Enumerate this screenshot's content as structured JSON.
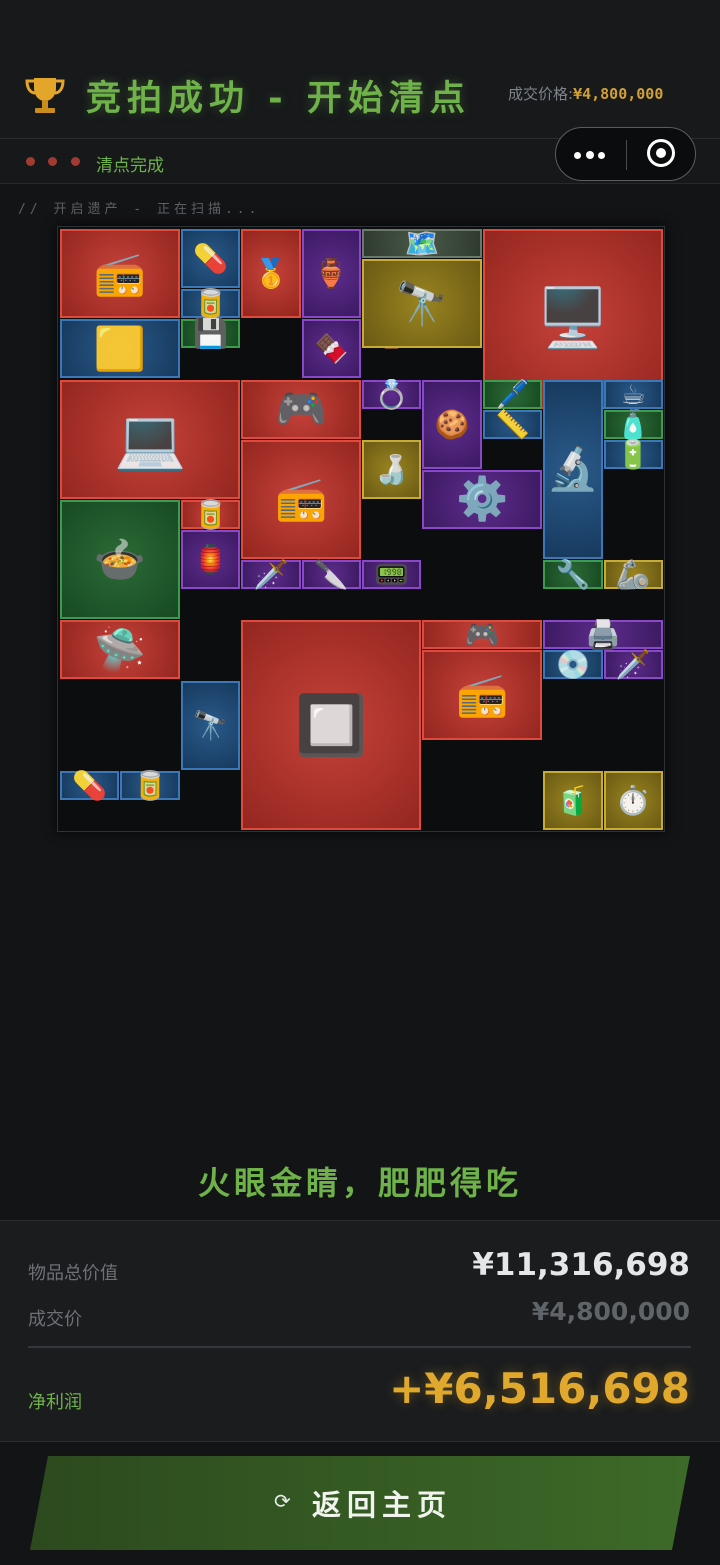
{
  "header": {
    "title": "竞拍成功 - 开始清点",
    "price_label": "成交价格:",
    "price_value": "¥4,800,000"
  },
  "status": {
    "text": "清点完成",
    "dot_color": "#a33a32"
  },
  "mini_program_menu": {
    "more_icon": "more-dots-icon",
    "close_icon": "target-close-icon"
  },
  "scan_text": "// 开启遗产 - 正在扫描...",
  "inventory": {
    "rarity_colors": {
      "red": "#c6423a",
      "blue": "#2a5a8a",
      "green": "#2c6a36",
      "purple": "#5d2c8c",
      "yellow": "#9a8420",
      "gray": "#4a5a4a"
    },
    "items": [
      {
        "name": "military-radio",
        "glyph": "📻",
        "rarity": "red"
      },
      {
        "name": "pill-pack",
        "glyph": "💊",
        "rarity": "blue"
      },
      {
        "name": "gold-bar",
        "glyph": "🥇",
        "rarity": "red"
      },
      {
        "name": "ornate-hookah",
        "glyph": "🏺",
        "rarity": "purple"
      },
      {
        "name": "treasure-map",
        "glyph": "🗺️",
        "rarity": "gray"
      },
      {
        "name": "server-rack",
        "glyph": "🖥️",
        "rarity": "red"
      },
      {
        "name": "ration-tin",
        "glyph": "🥫",
        "rarity": "blue"
      },
      {
        "name": "gold-plate",
        "glyph": "🟨",
        "rarity": "blue"
      },
      {
        "name": "circuit-board",
        "glyph": "💾",
        "rarity": "green"
      },
      {
        "name": "energy-bar",
        "glyph": "🍫",
        "rarity": "purple"
      },
      {
        "name": "smart-watch",
        "glyph": "⌚",
        "rarity": "red"
      },
      {
        "name": "binoculars",
        "glyph": "🔭",
        "rarity": "yellow"
      },
      {
        "name": "rugged-monitor",
        "glyph": "💻",
        "rarity": "red"
      },
      {
        "name": "graphics-card",
        "glyph": "🎮",
        "rarity": "red"
      },
      {
        "name": "gem-ring",
        "glyph": "💍",
        "rarity": "purple"
      },
      {
        "name": "gingerbread-man",
        "glyph": "🍪",
        "rarity": "purple"
      },
      {
        "name": "voltage-pen",
        "glyph": "🖊️",
        "rarity": "green"
      },
      {
        "name": "microscope",
        "glyph": "🔬",
        "rarity": "blue"
      },
      {
        "name": "teacup",
        "glyph": "☕",
        "rarity": "blue"
      },
      {
        "name": "caliper",
        "glyph": "📏",
        "rarity": "blue"
      },
      {
        "name": "pill-bottle",
        "glyph": "🧴",
        "rarity": "green"
      },
      {
        "name": "military-radio-2",
        "glyph": "📻",
        "rarity": "red"
      },
      {
        "name": "glass-decanter",
        "glyph": "🍶",
        "rarity": "yellow"
      },
      {
        "name": "enamel-pot",
        "glyph": "🍲",
        "rarity": "green"
      },
      {
        "name": "caviar-tin",
        "glyph": "🥫",
        "rarity": "red"
      },
      {
        "name": "centrifuge",
        "glyph": "⚙️",
        "rarity": "purple"
      },
      {
        "name": "battery-cells",
        "glyph": "🔋",
        "rarity": "blue"
      },
      {
        "name": "arabic-lantern",
        "glyph": "🏮",
        "rarity": "purple"
      },
      {
        "name": "spear-head",
        "glyph": "🗡️",
        "rarity": "purple"
      },
      {
        "name": "ceremonial-dagger",
        "glyph": "🔪",
        "rarity": "purple"
      },
      {
        "name": "controller-module",
        "glyph": "📟",
        "rarity": "purple"
      },
      {
        "name": "wrench",
        "glyph": "🔧",
        "rarity": "green"
      },
      {
        "name": "robot-part",
        "glyph": "🦾",
        "rarity": "yellow"
      },
      {
        "name": "drone",
        "glyph": "🛸",
        "rarity": "red"
      },
      {
        "name": "cpu-chip",
        "glyph": "🔲",
        "rarity": "red"
      },
      {
        "name": "graphics-card-2",
        "glyph": "🎮",
        "rarity": "red"
      },
      {
        "name": "network-card",
        "glyph": "🖨️",
        "rarity": "purple"
      },
      {
        "name": "spyglass",
        "glyph": "🔭",
        "rarity": "blue"
      },
      {
        "name": "military-radio-3",
        "glyph": "📻",
        "rarity": "red"
      },
      {
        "name": "compact-disc",
        "glyph": "💿",
        "rarity": "blue"
      },
      {
        "name": "jeweled-dagger",
        "glyph": "🗡️",
        "rarity": "purple"
      },
      {
        "name": "pill-pack-2",
        "glyph": "💊",
        "rarity": "blue"
      },
      {
        "name": "ration-tin-2",
        "glyph": "🥫",
        "rarity": "blue"
      },
      {
        "name": "soda-bottle",
        "glyph": "🧃",
        "rarity": "yellow"
      },
      {
        "name": "pocket-watch",
        "glyph": "⏱️",
        "rarity": "yellow"
      }
    ]
  },
  "slogan": "火眼金睛，肥肥得吃",
  "summary": {
    "total_label": "物品总价值",
    "total_value": "¥11,316,698",
    "deal_label": "成交价",
    "deal_value": "¥4,800,000",
    "profit_label": "净利润",
    "profit_value": "+¥6,516,698"
  },
  "back_button": {
    "icon": "⟳",
    "label": "返回主页"
  }
}
